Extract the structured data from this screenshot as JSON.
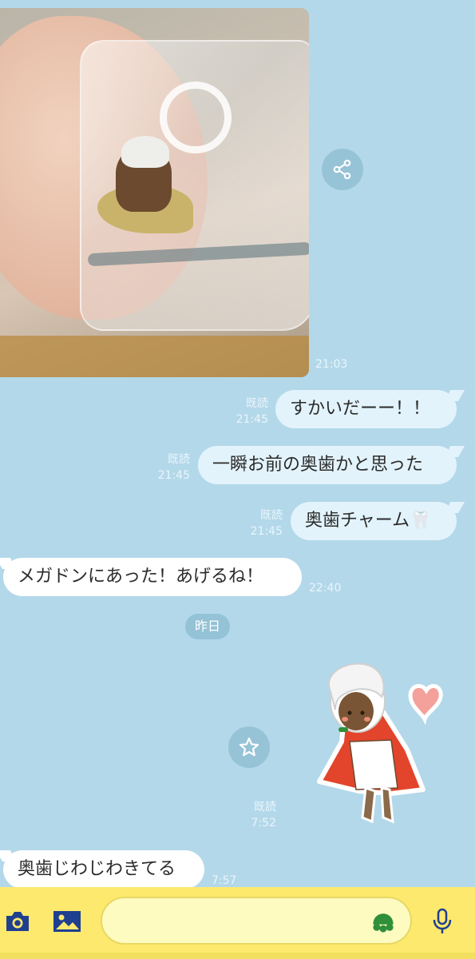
{
  "messages": {
    "photo_time": "21:03",
    "sent_1": {
      "text": "すかいだーー！！",
      "read": "既読",
      "time": "21:45"
    },
    "sent_2": {
      "text": "一瞬お前の奥歯かと思った",
      "read": "既読",
      "time": "21:45"
    },
    "sent_3": {
      "text": "奥歯チャーム🦷",
      "read": "既読",
      "time": "21:45"
    },
    "recv_1": {
      "text": "メガドンにあった！あげるね！",
      "time": "22:40"
    },
    "date_divider": "昨日",
    "sticker": {
      "read": "既読",
      "time": "7:52"
    },
    "recv_2": {
      "text": "奥歯じわじわきてる",
      "time": "7:57"
    }
  },
  "icons": {
    "share": "share-icon",
    "star": "star-icon",
    "camera": "camera-icon",
    "gallery": "image-icon",
    "emoji": "sticker-icon",
    "mic": "microphone-icon"
  },
  "colors": {
    "chat_background": "#b3d8ea",
    "sent_bubble": "#e2f3fb",
    "received_bubble": "#ffffff",
    "bottom_bar": "#fde96d",
    "icon_blue": "#1f3f8f",
    "sticker_green": "#2f8f3a"
  },
  "input": {
    "placeholder": ""
  }
}
